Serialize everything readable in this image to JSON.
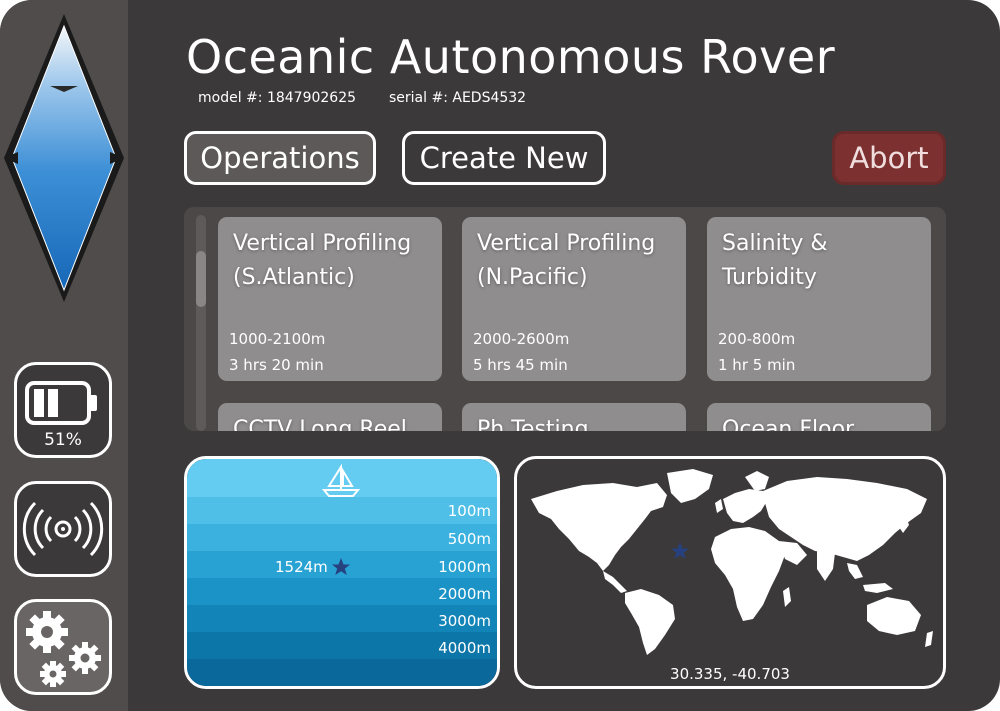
{
  "header": {
    "title": "Oceanic Autonomous Rover",
    "model": "model #: 1847902625",
    "serial": "serial #: AEDS4532"
  },
  "actions": {
    "operations_label": "Operations",
    "create_label": "Create New",
    "abort_label": "Abort"
  },
  "sidebar": {
    "compass_icon": "compass-needle-icon",
    "battery_icon": "battery-icon",
    "battery_level_percent": 51,
    "battery_label": "51%",
    "signal_icon": "signal-broadcast-icon",
    "settings_icon": "gears-icon"
  },
  "operations": [
    {
      "name": "Vertical Profiling (S.Atlantic)",
      "depth": "1000-2100m",
      "duration": "3 hrs 20 min"
    },
    {
      "name": "Vertical Profiling (N.Pacific)",
      "depth": "2000-2600m",
      "duration": "5 hrs 45 min"
    },
    {
      "name": "Salinity & Turbidity",
      "depth": "200-800m",
      "duration": "1 hr 5 min"
    },
    {
      "name": "CCTV Long Reel",
      "depth": "",
      "duration": ""
    },
    {
      "name": "Ph Testing",
      "depth": "",
      "duration": ""
    },
    {
      "name": "Ocean Floor",
      "depth": "",
      "duration": ""
    }
  ],
  "depth_gauge": {
    "levels": [
      "100m",
      "500m",
      "1000m",
      "2000m",
      "3000m",
      "4000m"
    ],
    "current_depth": "1524m",
    "surface_icon": "sailboat-icon",
    "marker_icon": "star-icon"
  },
  "map": {
    "coordinates": "30.335, -40.703",
    "marker_icon": "star-icon",
    "map_icon": "world-map-icon"
  },
  "colors": {
    "background": "#3b3939",
    "sidebar": "#514c4c",
    "card": "#8f8d8d",
    "abort": "#7c3030",
    "ocean_top": "#5fc8ee",
    "ocean_bottom": "#0a6e9e",
    "marker": "#27407e"
  }
}
